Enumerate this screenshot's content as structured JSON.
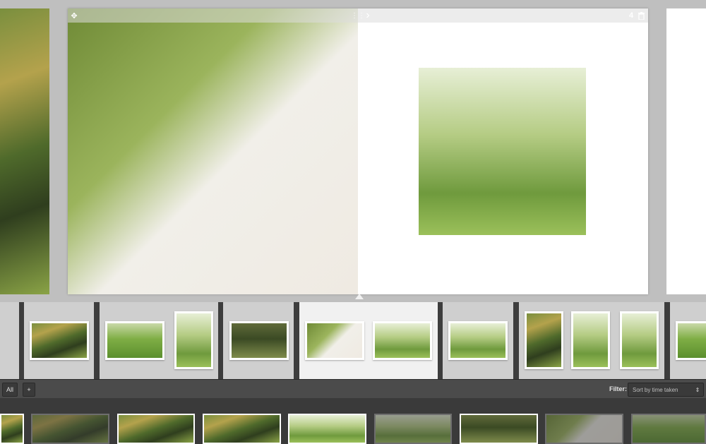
{
  "spread": {
    "page_number": "4",
    "icons": {
      "next": "chevron-right-icon",
      "delete": "trash-icon",
      "move": "move-icon",
      "grip": "grip-icon"
    }
  },
  "filter": {
    "label": "Filter:",
    "selected": "Sort by time taken"
  },
  "toolbar": {
    "all_label": "All",
    "add_label": "+"
  },
  "colors": {
    "stage_bg": "#bfbfbf",
    "filmstrip_bg": "#3d3d3d",
    "active_spread_bg": "#f1f1f1",
    "toolbar_bg": "#4b4b4b",
    "library_bg": "#3a3a3a"
  }
}
